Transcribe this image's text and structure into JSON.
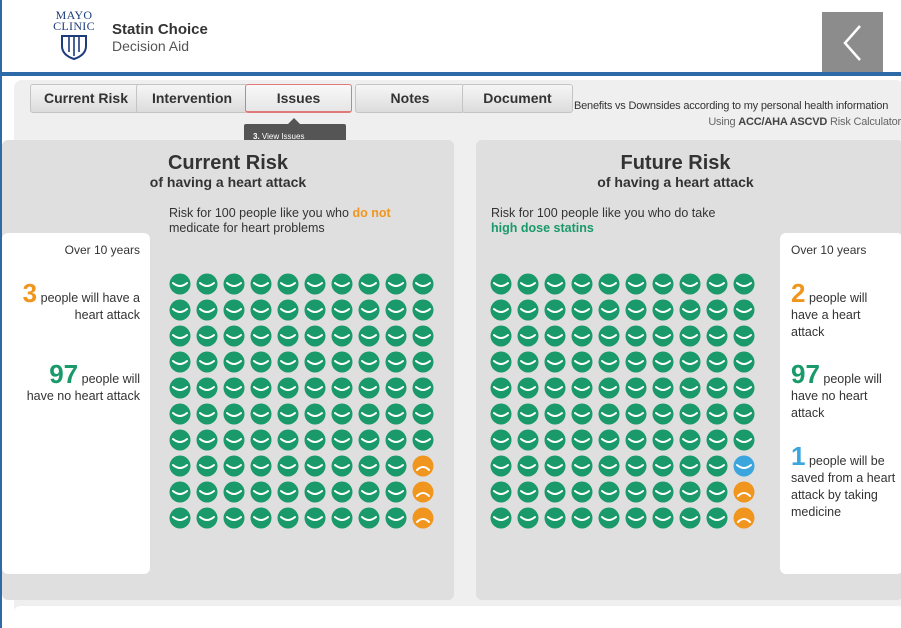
{
  "header": {
    "logo_text_line1": "MAYO",
    "logo_text_line2": "CLINIC",
    "title": "Statin Choice",
    "subtitle": "Decision Aid",
    "back_icon": "chevron-left-icon"
  },
  "tabs": [
    {
      "label": "Current Risk",
      "active": false
    },
    {
      "label": "Intervention",
      "active": false
    },
    {
      "label": "Issues",
      "active": true
    },
    {
      "label": "Notes",
      "active": false
    },
    {
      "label": "Document",
      "active": false
    }
  ],
  "tooltip": {
    "step": "3.",
    "text": "View Issues"
  },
  "summary": {
    "line1": "Benefits vs Downsides according to my personal health information",
    "line2_prefix": "Using",
    "line2_bold": "ACC/AHA ASCVD",
    "line2_suffix": "Risk Calculator"
  },
  "current": {
    "title": "Current Risk",
    "subtitle": "of having a heart attack",
    "desc_prefix": "Risk for 100 people like you who",
    "desc_highlight": "do not",
    "desc_line2": "medicate for heart problems",
    "period": "Over 10 years",
    "attack_count": "3",
    "attack_text": "people will have a heart attack",
    "safe_count": "97",
    "safe_text": "people will have no heart attack",
    "grid": {
      "green": 97,
      "orange": 3,
      "blue": 0
    }
  },
  "future": {
    "title": "Future Risk",
    "subtitle": "of having a heart attack",
    "desc_line1": "Risk for 100 people like you who do take",
    "desc_highlight": "high dose statins",
    "period": "Over 10 years",
    "attack_count": "2",
    "attack_text": "people will have a heart attack",
    "safe_count": "97",
    "safe_text": "people will have no heart attack",
    "saved_count": "1",
    "saved_text": "people will be saved from a heart attack by taking medicine",
    "grid": {
      "green": 97,
      "orange": 2,
      "blue": 1
    }
  },
  "colors": {
    "green": "#1a9a6a",
    "orange": "#f0961e",
    "blue": "#3aa6dd",
    "brand_blue": "#2f6aa8"
  }
}
